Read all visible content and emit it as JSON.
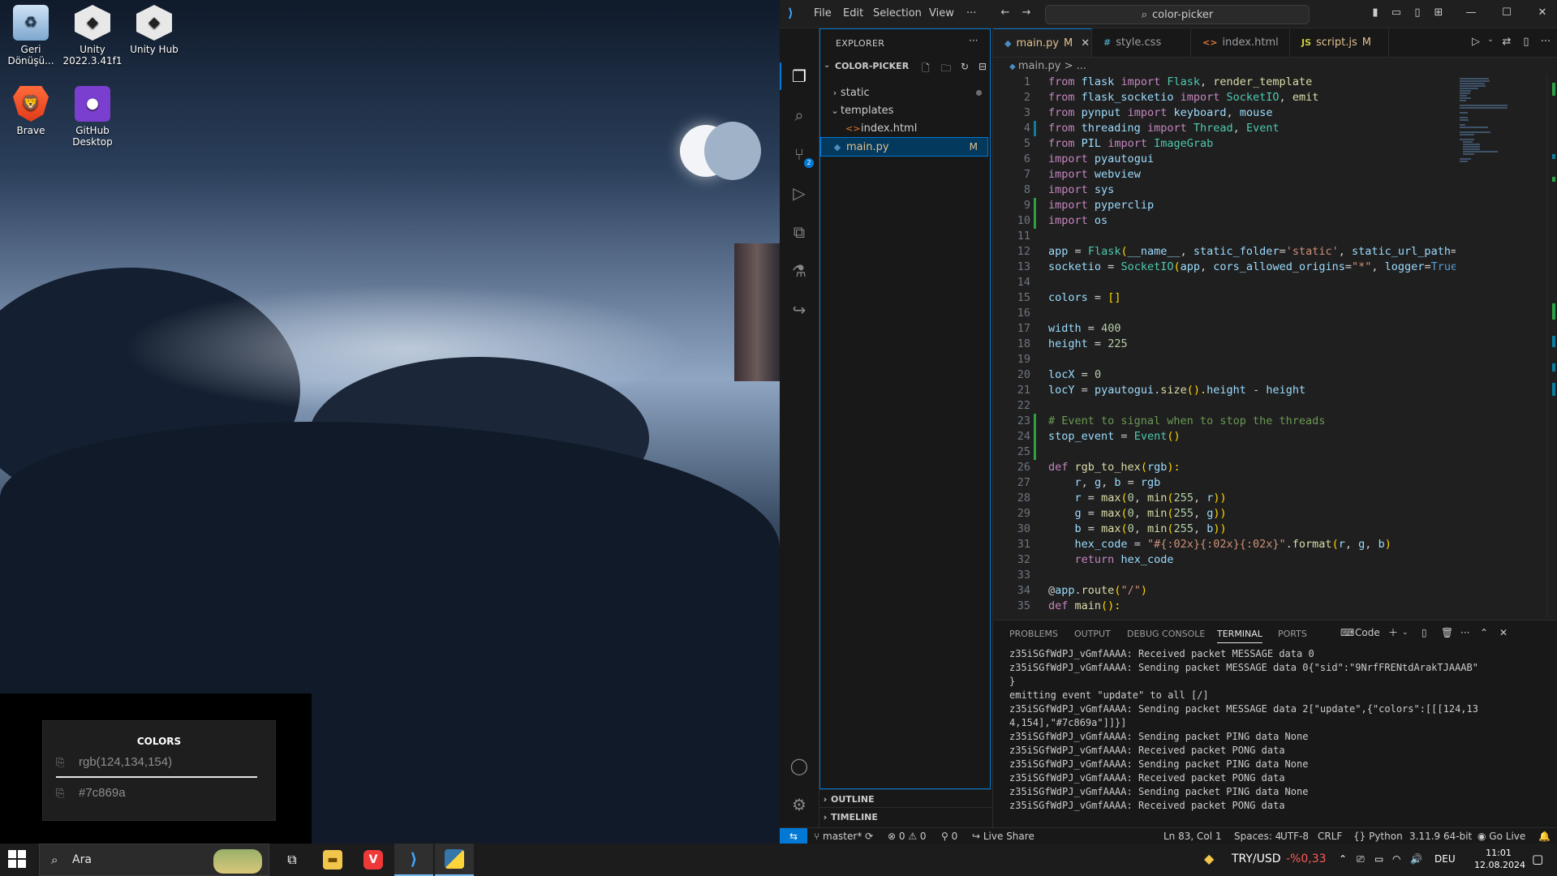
{
  "desktop": {
    "icons": [
      {
        "label": "Geri Dönüşü...",
        "icon": "recycle-bin"
      },
      {
        "label": "Unity 2022.3.41f1",
        "icon": "unity"
      },
      {
        "label": "Unity Hub",
        "icon": "unity-hub"
      },
      {
        "label": "Brave",
        "icon": "brave"
      },
      {
        "label": "GitHub Desktop",
        "icon": "github"
      }
    ]
  },
  "colors_widget": {
    "title": "COLORS",
    "rgb": "rgb(124,134,154)",
    "hex": "#7c869a"
  },
  "vscode": {
    "menu": [
      "File",
      "Edit",
      "Selection",
      "View",
      "···"
    ],
    "command_center": "color-picker",
    "explorer": {
      "title": "EXPLORER",
      "folder": "COLOR-PICKER",
      "tree": [
        {
          "name": "static",
          "type": "folder",
          "expanded": false
        },
        {
          "name": "templates",
          "type": "folder",
          "expanded": true
        },
        {
          "name": "index.html",
          "type": "html"
        },
        {
          "name": "main.py",
          "type": "python",
          "badge": "M"
        }
      ],
      "sections": [
        "OUTLINE",
        "TIMELINE"
      ]
    },
    "tabs": [
      {
        "label": "main.py",
        "badge": "M",
        "active": true,
        "icon": "python-icon"
      },
      {
        "label": "style.css",
        "badge": "",
        "active": false,
        "icon": "css-icon"
      },
      {
        "label": "index.html",
        "badge": "",
        "active": false,
        "icon": "html-icon"
      },
      {
        "label": "script.js",
        "badge": "M",
        "active": false,
        "icon": "js-icon"
      }
    ],
    "breadcrumb": "main.py > ...",
    "code_lines": [
      "from flask import Flask, render_template",
      "from flask_socketio import SocketIO, emit",
      "from pynput import keyboard, mouse",
      "from threading import Thread, Event",
      "from PIL import ImageGrab",
      "import pyautogui",
      "import webview",
      "import sys",
      "import pyperclip",
      "import os",
      "",
      "app = Flask(__name__, static_folder='static', static_url_path='/s",
      "socketio = SocketIO(app, cors_allowed_origins=\"*\", logger=True, e",
      "",
      "colors = []",
      "",
      "width = 400",
      "height = 225",
      "",
      "locX = 0",
      "locY = pyautogui.size().height - height",
      "",
      "# Event to signal when to stop the threads",
      "stop_event = Event()",
      "",
      "def rgb_to_hex(rgb):",
      "    r, g, b = rgb",
      "    r = max(0, min(255, r))",
      "    g = max(0, min(255, g))",
      "    b = max(0, min(255, b))",
      "    hex_code = \"#{:02x}{:02x}{:02x}\".format(r, g, b)",
      "    return hex_code",
      "",
      "@app.route(\"/\")",
      "def main():"
    ],
    "panel": {
      "tabs": [
        "PROBLEMS",
        "OUTPUT",
        "DEBUG CONSOLE",
        "TERMINAL",
        "PORTS"
      ],
      "active_tab": "TERMINAL",
      "terminal_name": "Code",
      "terminal_lines": [
        "z35iSGfWdPJ_vGmfAAAA: Received packet MESSAGE data 0",
        "z35iSGfWdPJ_vGmfAAAA: Sending packet MESSAGE data 0{\"sid\":\"9NrfFRENtdArakTJAAAB\"",
        "}",
        "emitting event \"update\" to all [/]",
        "z35iSGfWdPJ_vGmfAAAA: Sending packet MESSAGE data 2[\"update\",{\"colors\":[[[124,13",
        "4,154],\"#7c869a\"]]}]",
        "z35iSGfWdPJ_vGmfAAAA: Sending packet PING data None",
        "z35iSGfWdPJ_vGmfAAAA: Received packet PONG data",
        "z35iSGfWdPJ_vGmfAAAA: Sending packet PING data None",
        "z35iSGfWdPJ_vGmfAAAA: Received packet PONG data",
        "z35iSGfWdPJ_vGmfAAAA: Sending packet PING data None",
        "z35iSGfWdPJ_vGmfAAAA: Received packet PONG data"
      ]
    },
    "status": {
      "branch": "master*",
      "errors": "0",
      "warnings": "0",
      "ports": "0",
      "live_share": "Live Share",
      "position": "Ln 83, Col 1",
      "spaces": "Spaces: 4",
      "encoding": "UTF-8",
      "eol": "CRLF",
      "language": "Python",
      "interpreter": "3.11.9 64-bit",
      "go_live": "Go Live"
    }
  },
  "taskbar": {
    "search_text": "Ara",
    "ticker_pair": "TRY/USD",
    "ticker_change": "-%0,33",
    "language": "DEU",
    "time": "11:01",
    "date": "12.08.2024"
  },
  "colors": {
    "accent": "#0078d4",
    "modified": "#e2c08d",
    "ticker_negative": "#ff5a5a"
  }
}
